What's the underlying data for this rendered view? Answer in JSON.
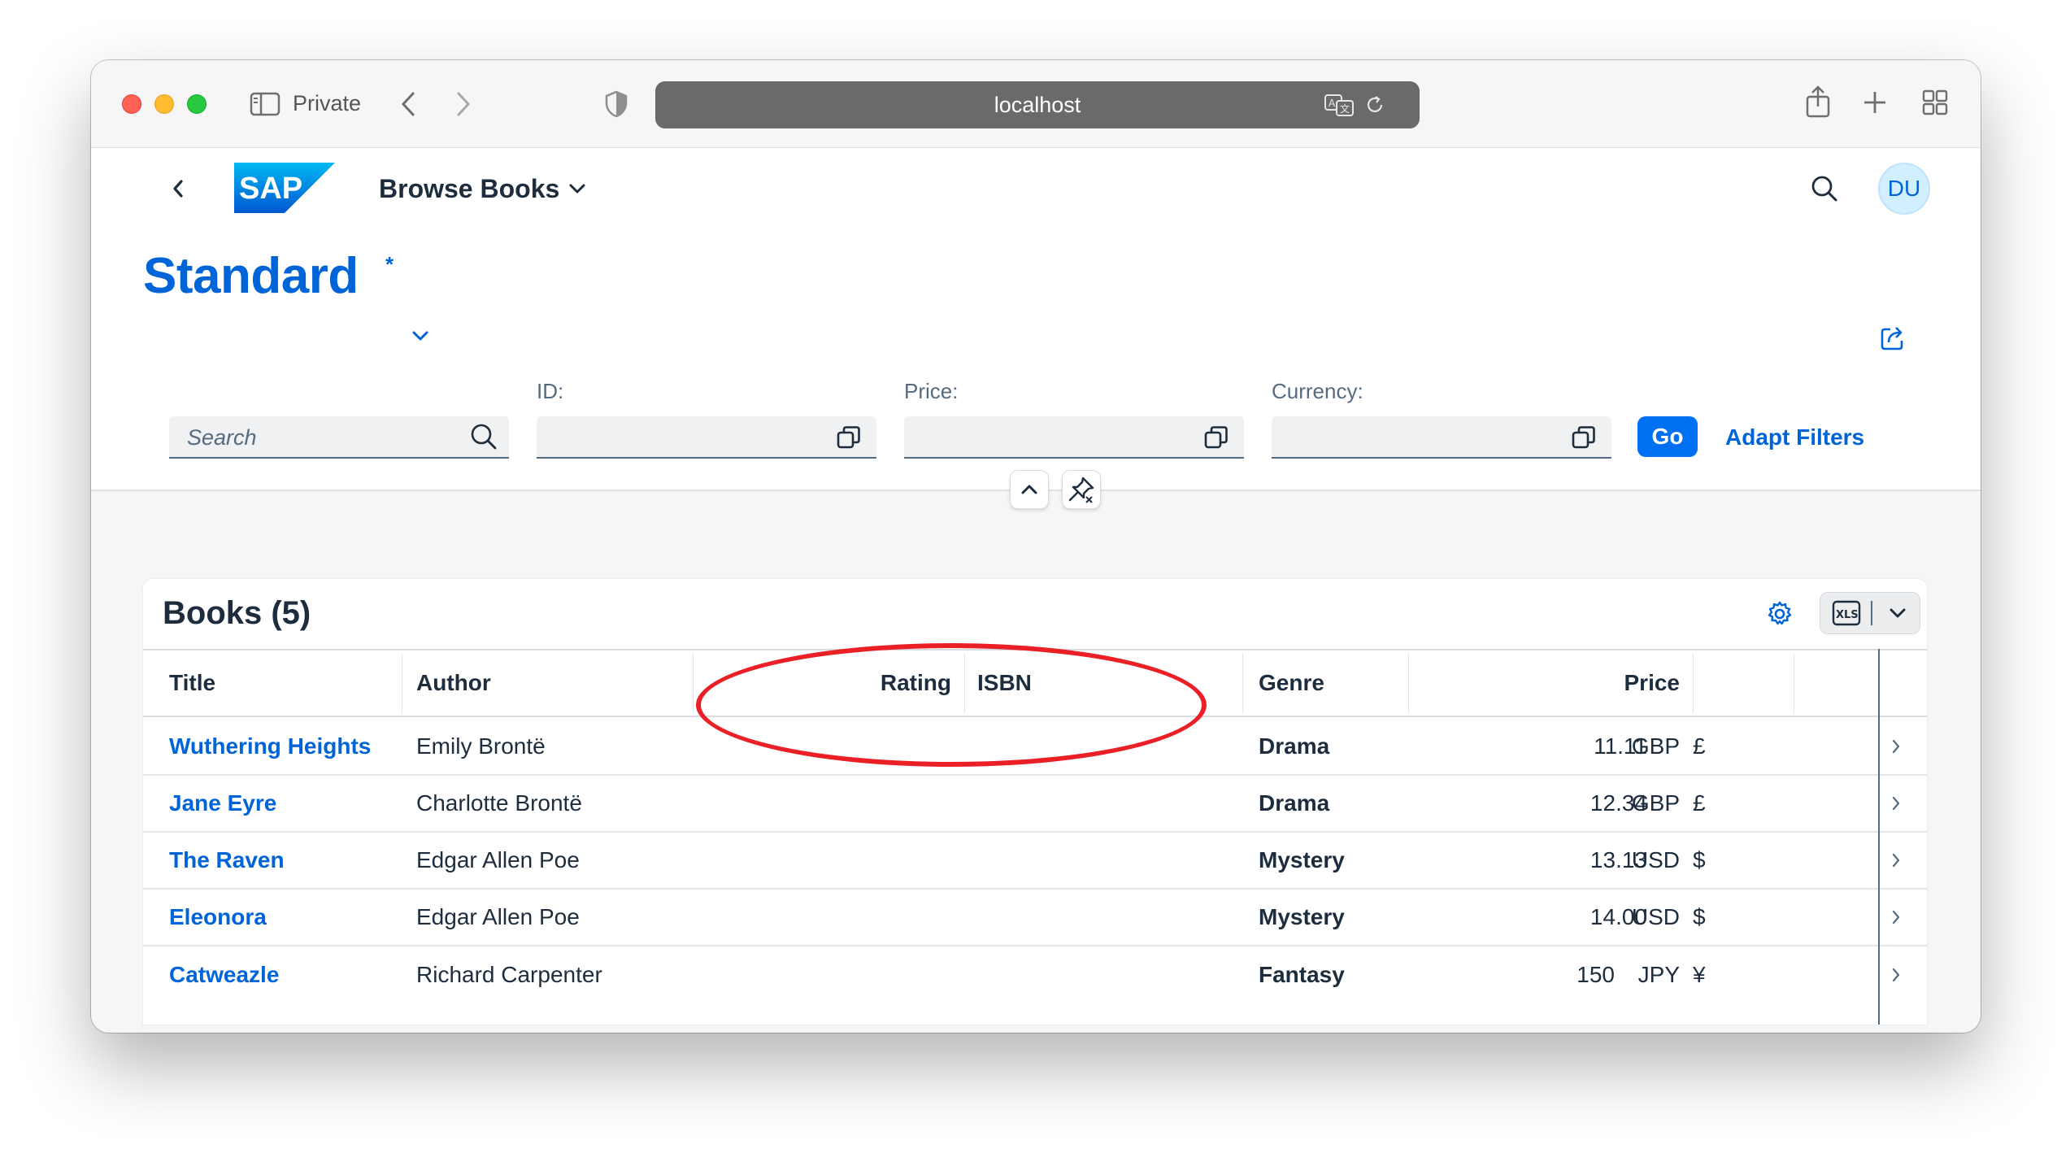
{
  "browser": {
    "private_label": "Private",
    "url": "localhost"
  },
  "shell": {
    "logo_text": "SAP",
    "app_title": "Browse Books",
    "avatar_initials": "DU"
  },
  "variant": {
    "name": "Standard",
    "modified_marker": "*"
  },
  "filters": {
    "search_placeholder": "Search",
    "fields": [
      {
        "label": "ID:",
        "value": ""
      },
      {
        "label": "Price:",
        "value": ""
      },
      {
        "label": "Currency:",
        "value": ""
      }
    ],
    "go_label": "Go",
    "adapt_label": "Adapt Filters"
  },
  "table": {
    "title": "Books (5)",
    "columns": [
      "Title",
      "Author",
      "Rating",
      "ISBN",
      "Genre",
      "Price"
    ],
    "rows": [
      {
        "title": "Wuthering Heights",
        "author": "Emily Brontë",
        "rating": "",
        "isbn": "",
        "genre": "Drama",
        "price": "11.11",
        "currency": "GBP",
        "symbol": "£"
      },
      {
        "title": "Jane Eyre",
        "author": "Charlotte Brontë",
        "rating": "",
        "isbn": "",
        "genre": "Drama",
        "price": "12.34",
        "currency": "GBP",
        "symbol": "£"
      },
      {
        "title": "The Raven",
        "author": "Edgar Allen Poe",
        "rating": "",
        "isbn": "",
        "genre": "Mystery",
        "price": "13.13",
        "currency": "USD",
        "symbol": "$"
      },
      {
        "title": "Eleonora",
        "author": "Edgar Allen Poe",
        "rating": "",
        "isbn": "",
        "genre": "Mystery",
        "price": "14.00",
        "currency": "USD",
        "symbol": "$"
      },
      {
        "title": "Catweazle",
        "author": "Richard Carpenter",
        "rating": "",
        "isbn": "",
        "genre": "Fantasy",
        "price": "150",
        "currency": "JPY",
        "symbol": "¥"
      }
    ]
  },
  "colors": {
    "accent": "#0064d9",
    "button": "#0070f2",
    "annotation": "#ea2026"
  },
  "icons": [
    "sidebar-icon",
    "back-icon",
    "forward-icon",
    "shield-icon",
    "translate-icon",
    "reload-icon",
    "share-icon",
    "new-tab-icon",
    "tab-overview-icon",
    "nav-back-icon",
    "chevron-down-icon",
    "search-icon",
    "export-share-icon",
    "value-help-icon",
    "collapse-icon",
    "pin-icon",
    "settings-gear-icon",
    "xls-export-icon",
    "chevron-right-icon"
  ]
}
